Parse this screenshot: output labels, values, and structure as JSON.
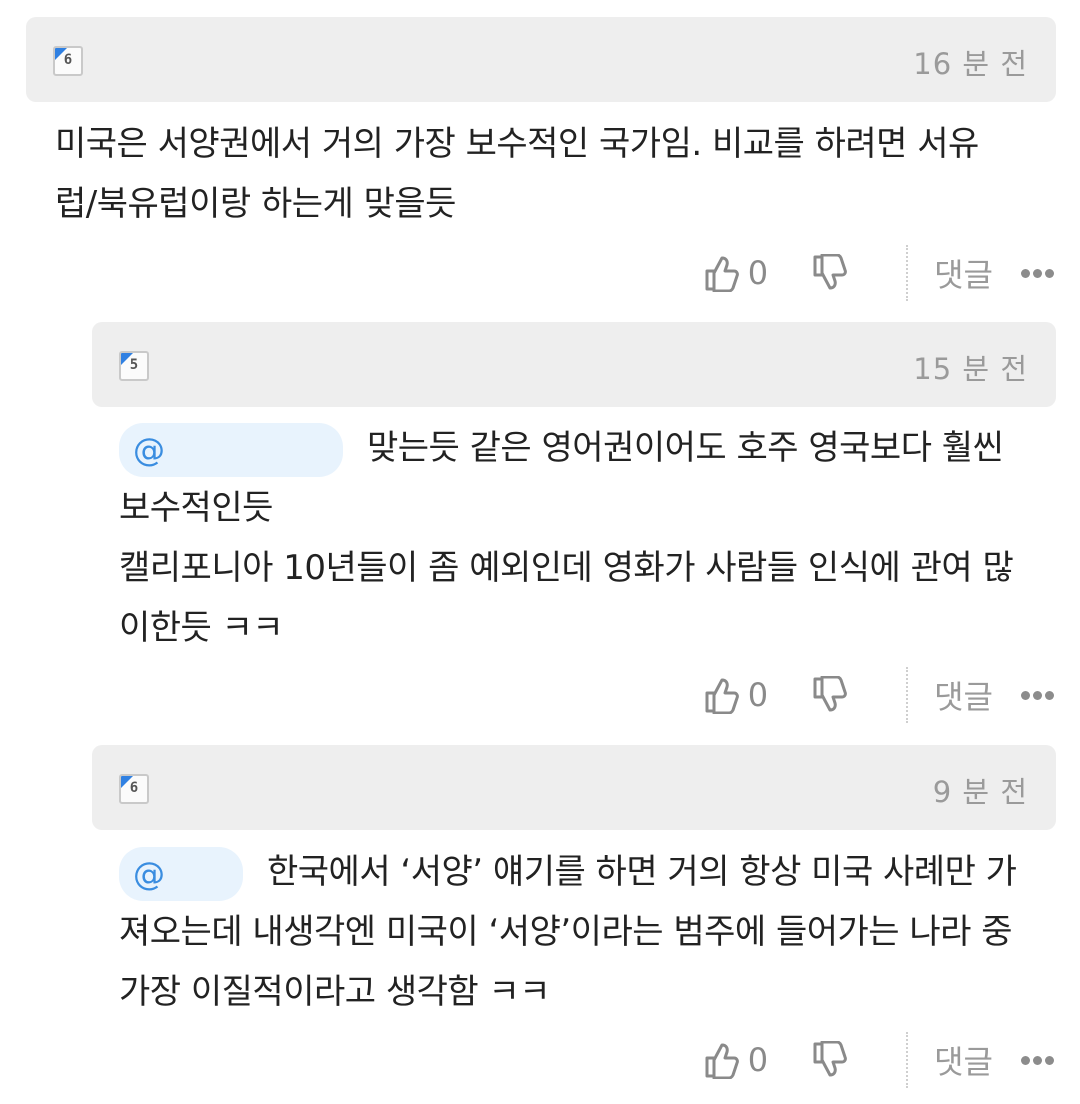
{
  "comments": [
    {
      "level": "6",
      "time": "16 분 전",
      "mention": "",
      "lines": [
        "미국은 서양권에서 거의 가장 보수적인 국가임. 비교를 하려면 서유",
        "럽/북유럽이랑 하는게 맞을듯"
      ],
      "likes": "0",
      "reply_label": "댓글"
    },
    {
      "level": "5",
      "time": "15 분 전",
      "mention": "@",
      "lines": [
        "맞는듯 같은 영어권이어도 호주 영국보다 훨씬",
        "보수적인듯",
        "캘리포니아 10년들이 좀 예외인데 영화가 사람들 인식에 관여 많",
        "이한듯 ㅋㅋ"
      ],
      "likes": "0",
      "reply_label": "댓글"
    },
    {
      "level": "6",
      "time": "9 분 전",
      "mention": "@",
      "lines": [
        "한국에서 ‘서양’ 얘기를 하면 거의 항상 미국 사례만 가",
        "져오는데 내생각엔 미국이 ‘서양’이라는 범주에 들어가는 나라 중",
        "가장 이질적이라고 생각함 ㅋㅋ"
      ],
      "likes": "0",
      "reply_label": "댓글"
    }
  ]
}
